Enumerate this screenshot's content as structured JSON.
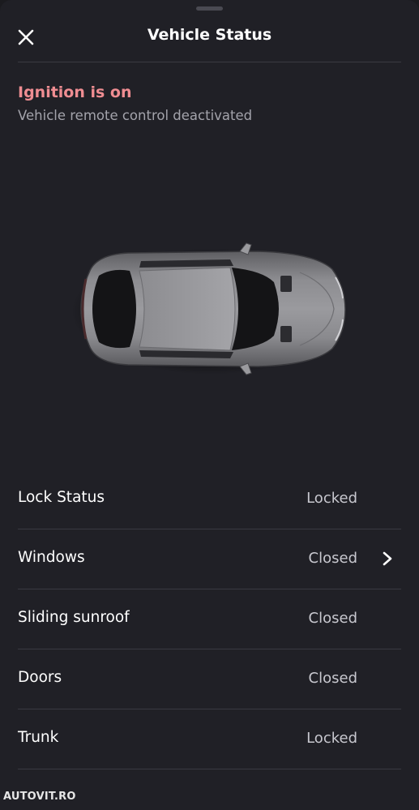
{
  "header": {
    "title": "Vehicle Status"
  },
  "ignition": {
    "title": "Ignition is on",
    "subtitle": "Vehicle remote control deactivated"
  },
  "status_rows": [
    {
      "label": "Lock Status",
      "value": "Locked",
      "has_chevron": false
    },
    {
      "label": "Windows",
      "value": "Closed",
      "has_chevron": true
    },
    {
      "label": "Sliding sunroof",
      "value": "Closed",
      "has_chevron": false
    },
    {
      "label": "Doors",
      "value": "Closed",
      "has_chevron": false
    },
    {
      "label": "Trunk",
      "value": "Locked",
      "has_chevron": false
    }
  ],
  "watermark": "AUTOVIT.RO",
  "icons": {
    "close": "close-icon",
    "chevron": "chevron-right-icon",
    "car": "car-top-view-image"
  },
  "colors": {
    "background": "#202026",
    "alert": "#ef8d92",
    "secondary_text": "#a3a3ab",
    "divider": "#3a3a42"
  }
}
